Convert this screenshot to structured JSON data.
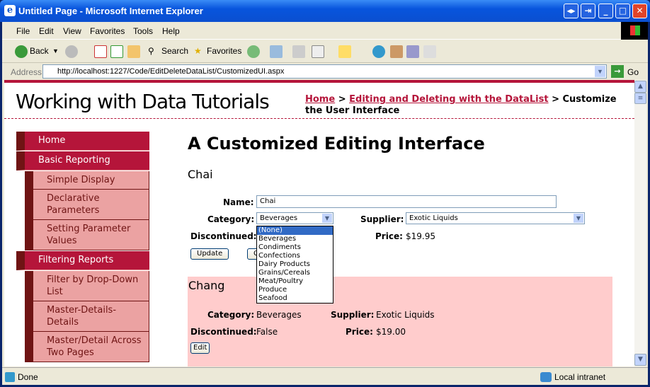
{
  "window": {
    "title": "Untitled Page - Microsoft Internet Explorer"
  },
  "menu": [
    "File",
    "Edit",
    "View",
    "Favorites",
    "Tools",
    "Help"
  ],
  "toolbar": {
    "back": "Back",
    "search": "Search",
    "favorites": "Favorites"
  },
  "address": {
    "label": "Address",
    "url": "http://localhost:1227/Code/EditDeleteDataList/CustomizedUI.aspx",
    "go": "Go"
  },
  "header": {
    "site_title": "Working with Data Tutorials",
    "crumb_home": "Home",
    "crumb_sep": " > ",
    "crumb_section": "Editing and Deleting with the DataList",
    "crumb_current": "Customize the User Interface"
  },
  "nav": {
    "home": "Home",
    "basic": "Basic Reporting",
    "basic_items": [
      "Simple Display",
      "Declarative Parameters",
      "Setting Parameter Values"
    ],
    "filtering": "Filtering Reports",
    "filtering_items": [
      "Filter by Drop-Down List",
      "Master-Details-Details",
      "Master/Detail Across Two Pages"
    ]
  },
  "main": {
    "heading": "A Customized Editing Interface",
    "edit_item": {
      "title": "Chai",
      "name_label": "Name:",
      "name_value": "Chai",
      "category_label": "Category:",
      "category_value": "Beverages",
      "supplier_label": "Supplier:",
      "supplier_value": "Exotic Liquids",
      "discontinued_label": "Discontinued:",
      "price_label": "Price:",
      "price_value": "$19.95",
      "update": "Update",
      "cancel": "Cancel",
      "category_options": [
        "(None)",
        "Beverages",
        "Condiments",
        "Confections",
        "Dairy Products",
        "Grains/Cereals",
        "Meat/Poultry",
        "Produce",
        "Seafood"
      ]
    },
    "item2": {
      "title": "Chang",
      "category_label": "Category:",
      "category_value": "Beverages",
      "supplier_label": "Supplier:",
      "supplier_value": "Exotic Liquids",
      "discontinued_label": "Discontinued:",
      "discontinued_value": "False",
      "price_label": "Price:",
      "price_value": "$19.00",
      "edit": "Edit"
    }
  },
  "status": {
    "text": "Done",
    "zone": "Local intranet"
  },
  "colors": {
    "accent": "#b5153a",
    "nav_sub": "#eba2a2",
    "item_bg": "#ffcccc"
  }
}
